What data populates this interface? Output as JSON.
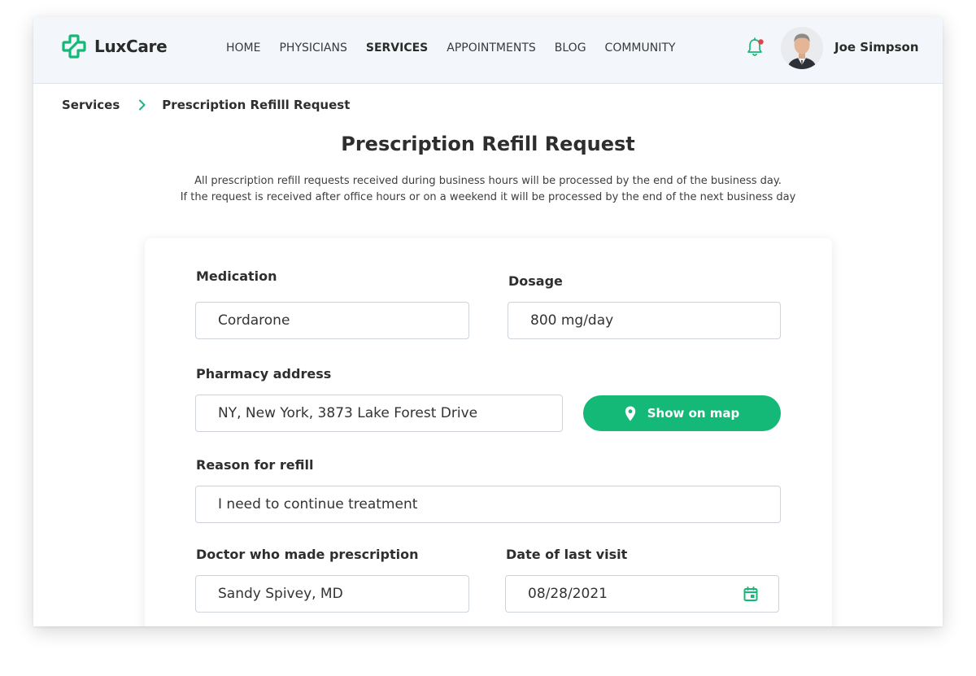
{
  "brand": {
    "name": "LuxCare",
    "accent": "#14b977"
  },
  "nav": {
    "items": [
      {
        "label": "HOME",
        "active": false
      },
      {
        "label": "PHYSICIANS",
        "active": false
      },
      {
        "label": "SERVICES",
        "active": true
      },
      {
        "label": "APPOINTMENTS",
        "active": false
      },
      {
        "label": "BLOG",
        "active": false
      },
      {
        "label": "COMMUNITY",
        "active": false
      }
    ]
  },
  "user": {
    "name": "Joe Simpson",
    "notification_icon": "bell-icon",
    "has_unread": true
  },
  "breadcrumb": {
    "parent": "Services",
    "current": "Prescription Refilll Request"
  },
  "page": {
    "title": "Prescription Refill Request",
    "notice_line1": "All prescription refill requests received during business hours will be processed by the end of the business day.",
    "notice_line2": "If the request is received after office hours or on a weekend it will be processed by the end of the next business day"
  },
  "form": {
    "medication": {
      "label": "Medication",
      "value": "Cordarone"
    },
    "dosage": {
      "label": "Dosage",
      "value": "800 mg/day"
    },
    "pharmacy": {
      "label": "Pharmacy address",
      "value": "NY, New York, 3873 Lake Forest Drive",
      "map_button": "Show on map"
    },
    "reason": {
      "label": "Reason for refill",
      "value": "I need to continue treatment"
    },
    "doctor": {
      "label": "Doctor who made prescription",
      "value": "Sandy Spivey, MD"
    },
    "last_visit": {
      "label": "Date of last visit",
      "value": "08/28/2021",
      "icon": "calendar-icon"
    }
  }
}
